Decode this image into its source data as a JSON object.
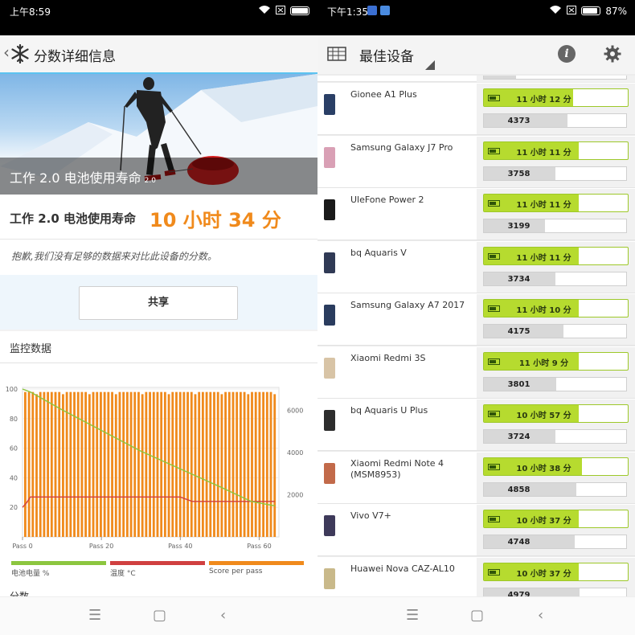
{
  "left": {
    "status": {
      "time": "上午8:59"
    },
    "header": {
      "back": "‹",
      "title": "分数详细信息"
    },
    "hero": {
      "caption_main": "工作 2.0 电池使用寿命",
      "caption_small": "2.0"
    },
    "score": {
      "label": "工作 2.0 电池使用寿命",
      "value": "10 小时 34 分"
    },
    "notice": "抱歉,我们没有足够的数据来对比此设备的分数。",
    "share_label": "共享",
    "monitor_title": "监控数据",
    "chart_data": {
      "type": "line",
      "title": "",
      "y_left_ticks": [
        "100",
        "80",
        "60",
        "40",
        "20"
      ],
      "y_right_ticks": [
        "6000",
        "4000",
        "2000"
      ],
      "x_ticks": [
        "Pass 0",
        "Pass 20",
        "Pass 40",
        "Pass 60"
      ],
      "ylim_left": [
        0,
        100
      ],
      "ylim_right": [
        0,
        7000
      ],
      "x_range": [
        0,
        65
      ],
      "bars_count": 67,
      "bar_value": 6860,
      "battery_series": {
        "name": "电池电量 %",
        "color": "#8cc63f",
        "x": [
          0,
          2,
          10,
          20,
          30,
          40,
          50,
          58,
          62,
          64
        ],
        "y": [
          100,
          98,
          86,
          72,
          58,
          46,
          34,
          24,
          22,
          21
        ]
      },
      "temp_series": {
        "name": "温度 °C",
        "color": "#d04040",
        "x": [
          0,
          1,
          2,
          4,
          40,
          43,
          62,
          64
        ],
        "y": [
          20,
          23,
          27,
          27,
          27,
          24,
          24,
          24
        ]
      },
      "score_series": {
        "name": "Score per pass",
        "color": "#f08a1c"
      },
      "legend": [
        "电池电量 %",
        "温度 °C",
        "Score per pass"
      ]
    },
    "cut_label": "分数"
  },
  "right": {
    "status": {
      "time": "下午1:35",
      "battery": "87%"
    },
    "header": {
      "title": "最佳设备"
    },
    "devices": [
      {
        "name": "Gionee A1 Plus",
        "time": "11 小时 12 分",
        "time_frac": 0.62,
        "score": "4373",
        "score_frac": 0.59,
        "color": "#2a3f66"
      },
      {
        "name": "Samsung Galaxy J7 Pro",
        "time": "11 小时 11 分",
        "time_frac": 0.66,
        "score": "3758",
        "score_frac": 0.5,
        "color": "#d9a0b5"
      },
      {
        "name": "UleFone Power 2",
        "time": "11 小时 11 分",
        "time_frac": 0.66,
        "score": "3199",
        "score_frac": 0.43,
        "color": "#1a1a1a"
      },
      {
        "name": "bq Aquaris V",
        "time": "11 小时 11 分",
        "time_frac": 0.66,
        "score": "3734",
        "score_frac": 0.5,
        "color": "#303a55"
      },
      {
        "name": "Samsung Galaxy A7 2017",
        "time": "11 小时 10 分",
        "time_frac": 0.66,
        "score": "4175",
        "score_frac": 0.56,
        "color": "#2a3c5e"
      },
      {
        "name": "Xiaomi Redmi 3S",
        "time": "11 小时 9 分",
        "time_frac": 0.66,
        "score": "3801",
        "score_frac": 0.51,
        "color": "#d8c4a6"
      },
      {
        "name": "bq Aquaris U Plus",
        "time": "10 小时 57 分",
        "time_frac": 0.66,
        "score": "3724",
        "score_frac": 0.5,
        "color": "#2d2d2d"
      },
      {
        "name": "Xiaomi Redmi Note 4 (MSM8953)",
        "time": "10 小时 38 分",
        "time_frac": 0.68,
        "score": "4858",
        "score_frac": 0.65,
        "color": "#c26a4a"
      },
      {
        "name": "Vivo V7+",
        "time": "10 小时 37 分",
        "time_frac": 0.66,
        "score": "4748",
        "score_frac": 0.64,
        "color": "#3e3a5a"
      },
      {
        "name": "Huawei Nova CAZ-AL10",
        "time": "10 小时 37 分",
        "time_frac": 0.66,
        "score": "4979",
        "score_frac": 0.67,
        "color": "#c9b98a"
      }
    ]
  }
}
